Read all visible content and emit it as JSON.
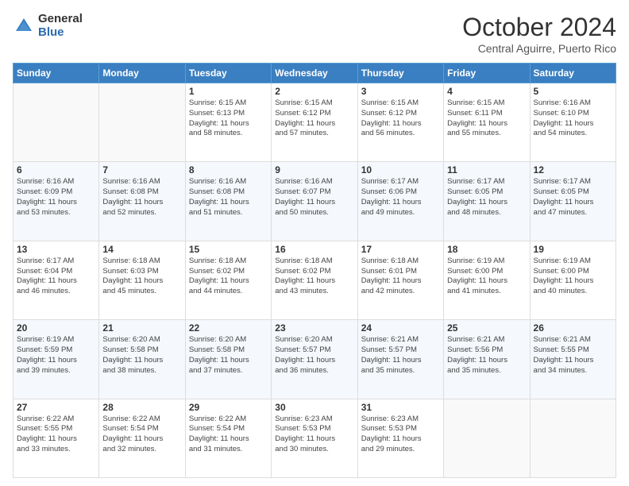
{
  "logo": {
    "general": "General",
    "blue": "Blue"
  },
  "header": {
    "month": "October 2024",
    "location": "Central Aguirre, Puerto Rico"
  },
  "weekdays": [
    "Sunday",
    "Monday",
    "Tuesday",
    "Wednesday",
    "Thursday",
    "Friday",
    "Saturday"
  ],
  "weeks": [
    [
      {
        "day": "",
        "info": ""
      },
      {
        "day": "",
        "info": ""
      },
      {
        "day": "1",
        "info": "Sunrise: 6:15 AM\nSunset: 6:13 PM\nDaylight: 11 hours\nand 58 minutes."
      },
      {
        "day": "2",
        "info": "Sunrise: 6:15 AM\nSunset: 6:12 PM\nDaylight: 11 hours\nand 57 minutes."
      },
      {
        "day": "3",
        "info": "Sunrise: 6:15 AM\nSunset: 6:12 PM\nDaylight: 11 hours\nand 56 minutes."
      },
      {
        "day": "4",
        "info": "Sunrise: 6:15 AM\nSunset: 6:11 PM\nDaylight: 11 hours\nand 55 minutes."
      },
      {
        "day": "5",
        "info": "Sunrise: 6:16 AM\nSunset: 6:10 PM\nDaylight: 11 hours\nand 54 minutes."
      }
    ],
    [
      {
        "day": "6",
        "info": "Sunrise: 6:16 AM\nSunset: 6:09 PM\nDaylight: 11 hours\nand 53 minutes."
      },
      {
        "day": "7",
        "info": "Sunrise: 6:16 AM\nSunset: 6:08 PM\nDaylight: 11 hours\nand 52 minutes."
      },
      {
        "day": "8",
        "info": "Sunrise: 6:16 AM\nSunset: 6:08 PM\nDaylight: 11 hours\nand 51 minutes."
      },
      {
        "day": "9",
        "info": "Sunrise: 6:16 AM\nSunset: 6:07 PM\nDaylight: 11 hours\nand 50 minutes."
      },
      {
        "day": "10",
        "info": "Sunrise: 6:17 AM\nSunset: 6:06 PM\nDaylight: 11 hours\nand 49 minutes."
      },
      {
        "day": "11",
        "info": "Sunrise: 6:17 AM\nSunset: 6:05 PM\nDaylight: 11 hours\nand 48 minutes."
      },
      {
        "day": "12",
        "info": "Sunrise: 6:17 AM\nSunset: 6:05 PM\nDaylight: 11 hours\nand 47 minutes."
      }
    ],
    [
      {
        "day": "13",
        "info": "Sunrise: 6:17 AM\nSunset: 6:04 PM\nDaylight: 11 hours\nand 46 minutes."
      },
      {
        "day": "14",
        "info": "Sunrise: 6:18 AM\nSunset: 6:03 PM\nDaylight: 11 hours\nand 45 minutes."
      },
      {
        "day": "15",
        "info": "Sunrise: 6:18 AM\nSunset: 6:02 PM\nDaylight: 11 hours\nand 44 minutes."
      },
      {
        "day": "16",
        "info": "Sunrise: 6:18 AM\nSunset: 6:02 PM\nDaylight: 11 hours\nand 43 minutes."
      },
      {
        "day": "17",
        "info": "Sunrise: 6:18 AM\nSunset: 6:01 PM\nDaylight: 11 hours\nand 42 minutes."
      },
      {
        "day": "18",
        "info": "Sunrise: 6:19 AM\nSunset: 6:00 PM\nDaylight: 11 hours\nand 41 minutes."
      },
      {
        "day": "19",
        "info": "Sunrise: 6:19 AM\nSunset: 6:00 PM\nDaylight: 11 hours\nand 40 minutes."
      }
    ],
    [
      {
        "day": "20",
        "info": "Sunrise: 6:19 AM\nSunset: 5:59 PM\nDaylight: 11 hours\nand 39 minutes."
      },
      {
        "day": "21",
        "info": "Sunrise: 6:20 AM\nSunset: 5:58 PM\nDaylight: 11 hours\nand 38 minutes."
      },
      {
        "day": "22",
        "info": "Sunrise: 6:20 AM\nSunset: 5:58 PM\nDaylight: 11 hours\nand 37 minutes."
      },
      {
        "day": "23",
        "info": "Sunrise: 6:20 AM\nSunset: 5:57 PM\nDaylight: 11 hours\nand 36 minutes."
      },
      {
        "day": "24",
        "info": "Sunrise: 6:21 AM\nSunset: 5:57 PM\nDaylight: 11 hours\nand 35 minutes."
      },
      {
        "day": "25",
        "info": "Sunrise: 6:21 AM\nSunset: 5:56 PM\nDaylight: 11 hours\nand 35 minutes."
      },
      {
        "day": "26",
        "info": "Sunrise: 6:21 AM\nSunset: 5:55 PM\nDaylight: 11 hours\nand 34 minutes."
      }
    ],
    [
      {
        "day": "27",
        "info": "Sunrise: 6:22 AM\nSunset: 5:55 PM\nDaylight: 11 hours\nand 33 minutes."
      },
      {
        "day": "28",
        "info": "Sunrise: 6:22 AM\nSunset: 5:54 PM\nDaylight: 11 hours\nand 32 minutes."
      },
      {
        "day": "29",
        "info": "Sunrise: 6:22 AM\nSunset: 5:54 PM\nDaylight: 11 hours\nand 31 minutes."
      },
      {
        "day": "30",
        "info": "Sunrise: 6:23 AM\nSunset: 5:53 PM\nDaylight: 11 hours\nand 30 minutes."
      },
      {
        "day": "31",
        "info": "Sunrise: 6:23 AM\nSunset: 5:53 PM\nDaylight: 11 hours\nand 29 minutes."
      },
      {
        "day": "",
        "info": ""
      },
      {
        "day": "",
        "info": ""
      }
    ]
  ]
}
